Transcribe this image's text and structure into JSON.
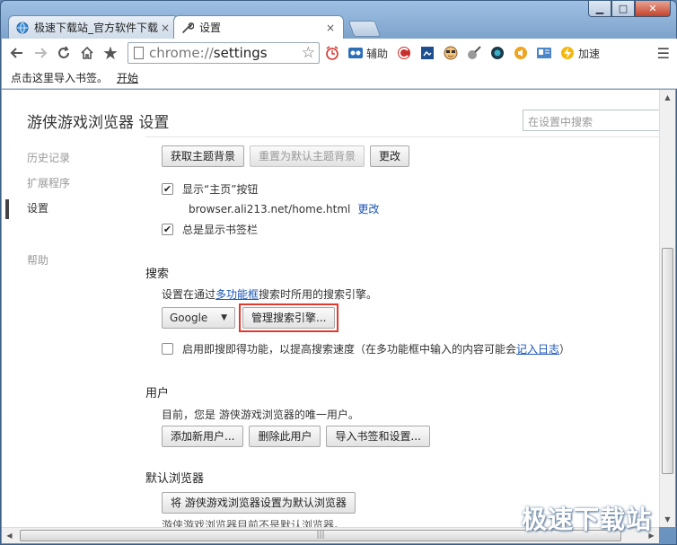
{
  "window": {
    "minimize_glyph": "▁",
    "maximize_glyph": "□",
    "close_glyph": "✕"
  },
  "tabs": [
    {
      "title": "极速下载站_官方软件下载",
      "icon": "globe-icon",
      "close": "×"
    },
    {
      "title": "设置",
      "icon": "wrench-icon",
      "close": "×"
    }
  ],
  "toolbar": {
    "url_prefix": "chrome://",
    "url_host": "settings",
    "ext_fuzhu_label": "辅助",
    "ext_jiasu_label": "加速"
  },
  "bookmarks_bar": {
    "prompt": "点击这里导入书签。",
    "start_link": "开始"
  },
  "page": {
    "title": "游侠游戏浏览器 设置",
    "search_placeholder": "在设置中搜索"
  },
  "sidebar": {
    "items": [
      "历史记录",
      "扩展程序",
      "设置",
      "帮助"
    ],
    "active": "设置"
  },
  "appearance": {
    "get_theme_button": "获取主题背景",
    "reset_theme_button": "重置为默认主题背景",
    "change_button": "更改",
    "show_home_label": "显示“主页”按钮",
    "show_home_checked": true,
    "home_url": "browser.ali213.net/home.html",
    "home_change_link": "更改",
    "always_show_bookmarks_label": "总是显示书签栏",
    "always_show_bookmarks_checked": true
  },
  "search": {
    "heading": "搜索",
    "description_prefix": "设置在通过",
    "description_link": "多功能框",
    "description_suffix": "搜索时所用的搜索引擎。",
    "engine_selected": "Google",
    "manage_button": "管理搜索引擎...",
    "instant_label_prefix": "启用即搜即得功能，以提高搜索速度（在多功能框中输入的内容可能会",
    "instant_label_link": "记入日志",
    "instant_label_suffix": "）",
    "instant_checked": false
  },
  "users": {
    "heading": "用户",
    "description": "目前，您是 游侠游戏浏览器的唯一用户。",
    "add_button": "添加新用户...",
    "delete_button": "删除此用户",
    "import_button": "导入书签和设置..."
  },
  "default_browser": {
    "heading": "默认浏览器",
    "set_default_button": "将 游侠游戏浏览器设置为默认浏览器",
    "status_cut": "游侠游戏浏览器目前不是默认浏览器。"
  },
  "watermark": "极速下载站",
  "colors": {
    "link": "#1a55b8",
    "highlight": "#e03a2e",
    "frame": "#7fa4cc"
  }
}
